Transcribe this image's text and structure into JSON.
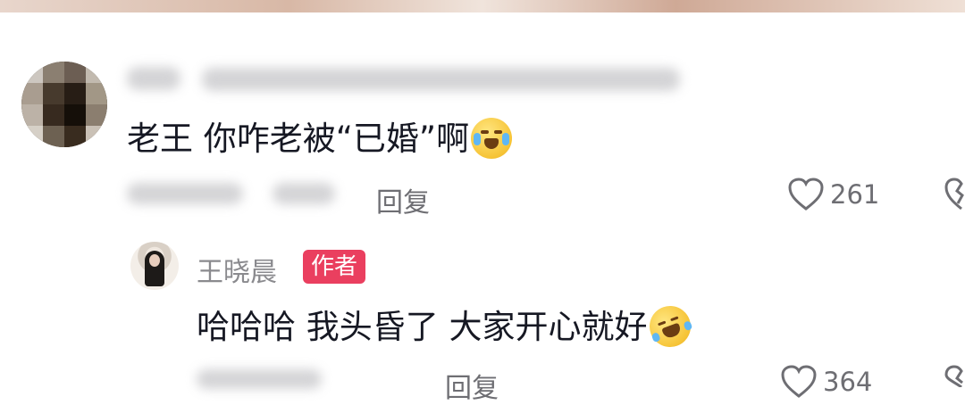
{
  "comments": [
    {
      "text": "老王 你咋老被“已婚”啊",
      "reply_label": "回复",
      "like_count": "261"
    },
    {
      "author": "王晓晨",
      "badge": "作者",
      "text": "哈哈哈 我头昏了 大家开心就好",
      "reply_label": "回复",
      "like_count": "364"
    }
  ],
  "icons": {
    "like": "heart-icon",
    "dislike": "broken-heart-icon",
    "emoji_comment": "crying-face-emoji",
    "emoji_reply": "laughing-tears-emoji"
  }
}
